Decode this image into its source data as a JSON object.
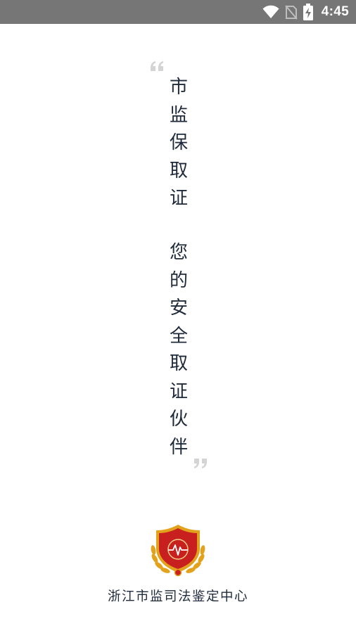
{
  "status_bar": {
    "time": "4:45",
    "icons": [
      "wifi-icon",
      "no-sim-icon",
      "battery-charging-icon"
    ]
  },
  "splash": {
    "slogan_part1": [
      "市",
      "监",
      "保",
      "取",
      "证"
    ],
    "slogan_part2": [
      "您",
      "的",
      "安",
      "全",
      "取",
      "证",
      "伙",
      "伴"
    ],
    "organization_name": "浙江市监司法鉴定中心",
    "colors": {
      "text": "#1f2a3a",
      "quote_marks": "#d4d4d4",
      "status_bar": "#767676",
      "emblem_red": "#c8201e",
      "emblem_gold": "#e2a21c"
    }
  }
}
